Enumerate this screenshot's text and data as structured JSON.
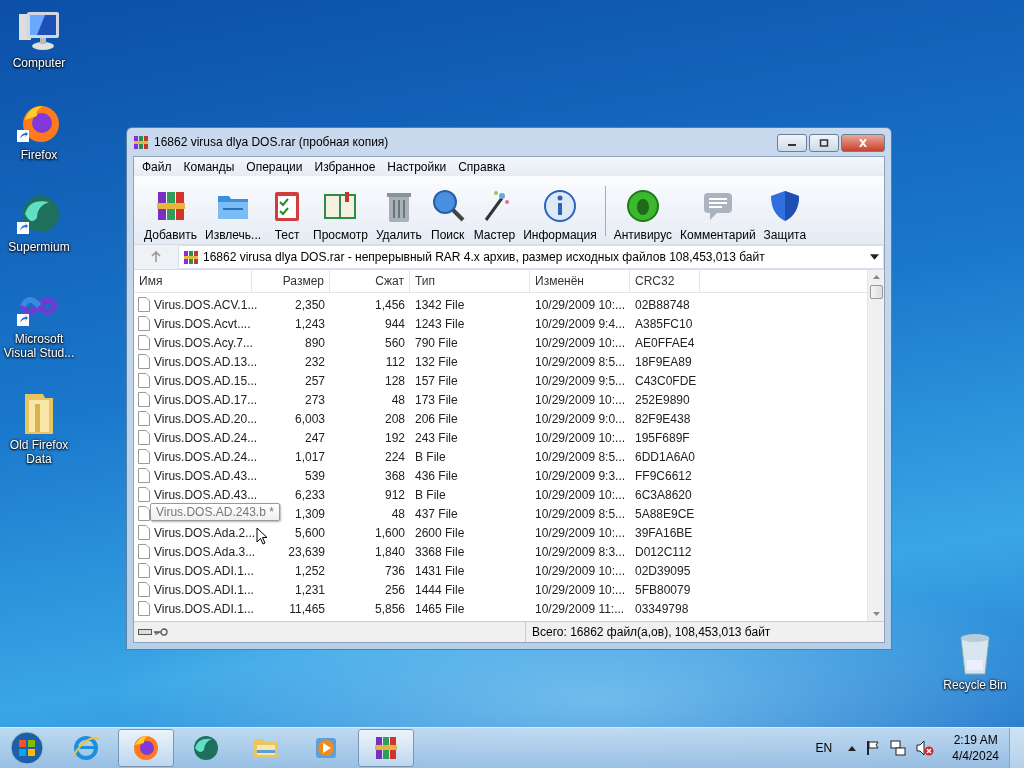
{
  "desktop_icons": [
    {
      "label": "Computer",
      "kind": "computer",
      "shortcut": false
    },
    {
      "label": "Firefox",
      "kind": "firefox",
      "shortcut": true
    },
    {
      "label": "Supermium",
      "kind": "supermium",
      "shortcut": true
    },
    {
      "label": "Microsoft Visual Stud...",
      "kind": "vs",
      "shortcut": true
    },
    {
      "label": "Old Firefox Data",
      "kind": "folder",
      "shortcut": false
    }
  ],
  "recycle_bin": {
    "label": "Recycle Bin"
  },
  "window": {
    "title": "16862 virusa dlya DOS.rar (пробная копия)",
    "menu": [
      "Файл",
      "Команды",
      "Операции",
      "Избранное",
      "Настройки",
      "Справка"
    ],
    "toolbar_groups": [
      {
        "buttons": [
          {
            "label": "Добавить",
            "kind": "add"
          },
          {
            "label": "Извлечь...",
            "kind": "extract"
          },
          {
            "label": "Тест",
            "kind": "test"
          },
          {
            "label": "Просмотр",
            "kind": "view"
          },
          {
            "label": "Удалить",
            "kind": "delete"
          },
          {
            "label": "Поиск",
            "kind": "find"
          },
          {
            "label": "Мастер",
            "kind": "wizard"
          },
          {
            "label": "Информация",
            "kind": "info"
          }
        ]
      },
      {
        "buttons": [
          {
            "label": "Антивирус",
            "kind": "virus"
          },
          {
            "label": "Комментарий",
            "kind": "comment"
          },
          {
            "label": "Защита",
            "kind": "protect"
          }
        ]
      }
    ],
    "path": "16862 virusa dlya DOS.rar - непрерывный RAR 4.x архив, размер исходных файлов 108,453,013 байт",
    "columns": [
      "Имя",
      "Размер",
      "Сжат",
      "Тип",
      "Изменён",
      "CRC32"
    ],
    "rows": [
      {
        "name": "Virus.DOS.ACV.1...",
        "size": "2,350",
        "packed": "1,456",
        "type": "1342 File",
        "modified": "10/29/2009 10:...",
        "crc": "02B88748"
      },
      {
        "name": "Virus.DOS.Acvt....",
        "size": "1,243",
        "packed": "944",
        "type": "1243 File",
        "modified": "10/29/2009 9:4...",
        "crc": "A385FC10"
      },
      {
        "name": "Virus.DOS.Acy.7...",
        "size": "890",
        "packed": "560",
        "type": "790 File",
        "modified": "10/29/2009 10:...",
        "crc": "AE0FFAE4"
      },
      {
        "name": "Virus.DOS.AD.13...",
        "size": "232",
        "packed": "112",
        "type": "132 File",
        "modified": "10/29/2009 8:5...",
        "crc": "18F9EA89"
      },
      {
        "name": "Virus.DOS.AD.15...",
        "size": "257",
        "packed": "128",
        "type": "157 File",
        "modified": "10/29/2009 9:5...",
        "crc": "C43C0FDE"
      },
      {
        "name": "Virus.DOS.AD.17...",
        "size": "273",
        "packed": "48",
        "type": "173 File",
        "modified": "10/29/2009 10:...",
        "crc": "252E9890"
      },
      {
        "name": "Virus.DOS.AD.20...",
        "size": "6,003",
        "packed": "208",
        "type": "206 File",
        "modified": "10/29/2009 9:0...",
        "crc": "82F9E438"
      },
      {
        "name": "Virus.DOS.AD.24...",
        "size": "247",
        "packed": "192",
        "type": "243 File",
        "modified": "10/29/2009 10:...",
        "crc": "195F689F"
      },
      {
        "name": "Virus.DOS.AD.24...",
        "size": "1,017",
        "packed": "224",
        "type": "B File",
        "modified": "10/29/2009 8:5...",
        "crc": "6DD1A6A0"
      },
      {
        "name": "Virus.DOS.AD.43...",
        "size": "539",
        "packed": "368",
        "type": "436 File",
        "modified": "10/29/2009 9:3...",
        "crc": "FF9C6612"
      },
      {
        "name": "Virus.DOS.AD.43...",
        "size": "6,233",
        "packed": "912",
        "type": "B File",
        "modified": "10/29/2009 10:...",
        "crc": "6C3A8620"
      },
      {
        "size": "1,309",
        "packed": "48",
        "type": "437 File",
        "modified": "10/29/2009 8:5...",
        "crc": "5A88E9CE"
      },
      {
        "name": "Virus.DOS.Ada.2...",
        "size": "5,600",
        "packed": "1,600",
        "type": "2600 File",
        "modified": "10/29/2009 10:...",
        "crc": "39FA16BE"
      },
      {
        "name": "Virus.DOS.Ada.3...",
        "size": "23,639",
        "packed": "1,840",
        "type": "3368 File",
        "modified": "10/29/2009 8:3...",
        "crc": "D012C112"
      },
      {
        "name": "Virus.DOS.ADI.1...",
        "size": "1,252",
        "packed": "736",
        "type": "1431 File",
        "modified": "10/29/2009 10:...",
        "crc": "02D39095"
      },
      {
        "name": "Virus.DOS.ADI.1...",
        "size": "1,231",
        "packed": "256",
        "type": "1444 File",
        "modified": "10/29/2009 10:...",
        "crc": "5FB80079"
      },
      {
        "name": "Virus.DOS.ADI.1...",
        "size": "11,465",
        "packed": "5,856",
        "type": "1465 File",
        "modified": "10/29/2009 11:...",
        "crc": "03349798"
      }
    ],
    "tooltip": {
      "text": "Virus.DOS.AD.243.b *"
    },
    "status": "Всего: 16862 файл(а,ов), 108,453,013 байт"
  },
  "taskbar": {
    "apps": [
      {
        "kind": "ie",
        "selected": false
      },
      {
        "kind": "firefox",
        "selected": true
      },
      {
        "kind": "supermium",
        "selected": false
      },
      {
        "kind": "explorer",
        "selected": false
      },
      {
        "kind": "media",
        "selected": false
      },
      {
        "kind": "winrar",
        "selected": true
      }
    ],
    "language": "EN",
    "time": "2:19 AM",
    "date": "4/4/2024"
  }
}
